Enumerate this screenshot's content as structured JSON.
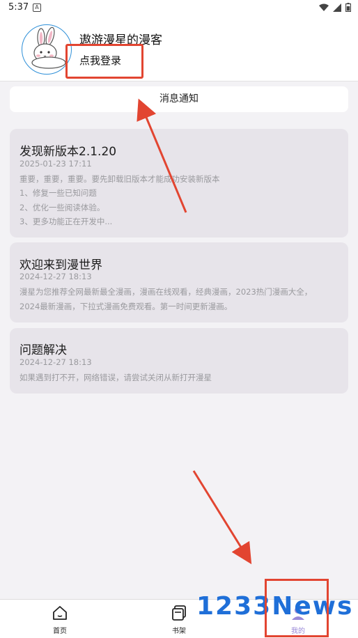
{
  "status_bar": {
    "time": "5:37",
    "badge": "A",
    "icons": [
      "wifi-icon",
      "signal-icon",
      "battery-icon"
    ]
  },
  "profile": {
    "username": "遨游漫星的漫客",
    "login_label": "点我登录",
    "avatar_icon": "rabbit-avatar-icon",
    "avatar_border_color": "#2d8fd8"
  },
  "notice_button": {
    "label": "消息通知"
  },
  "announcements": [
    {
      "title": "发现新版本2.1.20",
      "date": "2025-01-23 17:11",
      "lines": [
        "重要，重要，重要。要先卸载旧版本才能成功安装新版本",
        "1、修复一些已知问题",
        "2、优化一些阅读体验。",
        "3、更多功能正在开发中..."
      ]
    },
    {
      "title": "欢迎来到漫世界",
      "date": "2024-12-27 18:13",
      "lines": [
        "漫星为您推荐全网最新最全漫画，漫画在线观看，经典漫画，2023热门漫画大全，",
        "2024最新漫画，下拉式漫画免费观看。第一时间更新漫画。"
      ]
    },
    {
      "title": "问题解决",
      "date": "2024-12-27 18:13",
      "lines": [
        "如果遇到打不开，网络错误，请尝试关闭从新打开漫星"
      ]
    }
  ],
  "tabs": [
    {
      "label": "首页",
      "icon": "home-icon",
      "active": false
    },
    {
      "label": "书架",
      "icon": "bookshelf-icon",
      "active": false
    },
    {
      "label": "我的",
      "icon": "profile-icon",
      "active": true
    }
  ],
  "watermark": {
    "text": "1233News",
    "color": "#1f6fd8"
  },
  "colors": {
    "accent": "#9a89d8",
    "annotation": "#e24531",
    "card_bg": "#e7e4ea",
    "page_bg": "#f3f2f5"
  }
}
